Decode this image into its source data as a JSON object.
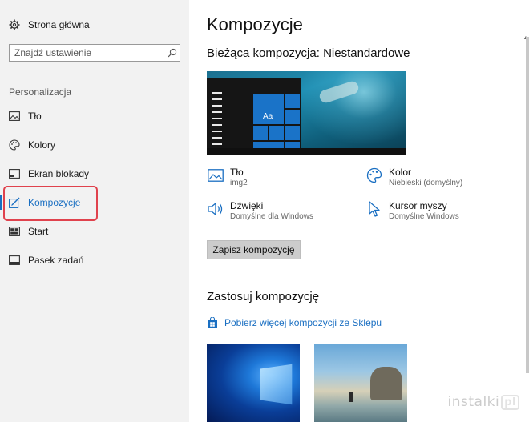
{
  "sidebar": {
    "home_label": "Strona główna",
    "search_placeholder": "Znajdź ustawienie",
    "section_label": "Personalizacja",
    "items": [
      {
        "label": "Tło",
        "icon": "image-icon"
      },
      {
        "label": "Kolory",
        "icon": "palette-icon"
      },
      {
        "label": "Ekran blokady",
        "icon": "lock-screen-icon"
      },
      {
        "label": "Kompozycje",
        "icon": "themes-icon",
        "active": true
      },
      {
        "label": "Start",
        "icon": "start-icon"
      },
      {
        "label": "Pasek zadań",
        "icon": "taskbar-icon"
      }
    ]
  },
  "main": {
    "title": "Kompozycje",
    "current_theme": "Bieżąca kompozycja: Niestandardowe",
    "preview_tile_label": "Aa",
    "properties": {
      "background": {
        "name": "Tło",
        "value": "img2"
      },
      "color": {
        "name": "Kolor",
        "value": "Niebieski (domyślny)"
      },
      "sounds": {
        "name": "Dźwięki",
        "value": "Domyślne dla Windows"
      },
      "cursor": {
        "name": "Kursor myszy",
        "value": "Domyślne Windows"
      }
    },
    "save_button": "Zapisz kompozycję",
    "apply_title": "Zastosuj kompozycję",
    "store_link": "Pobierz więcej kompozycji ze Sklepu"
  },
  "watermark": {
    "text": "instalki",
    "badge": "pl"
  },
  "colors": {
    "accent": "#1a6fc2",
    "highlight": "#e0424d",
    "sidebar_bg": "#f2f2f2"
  }
}
